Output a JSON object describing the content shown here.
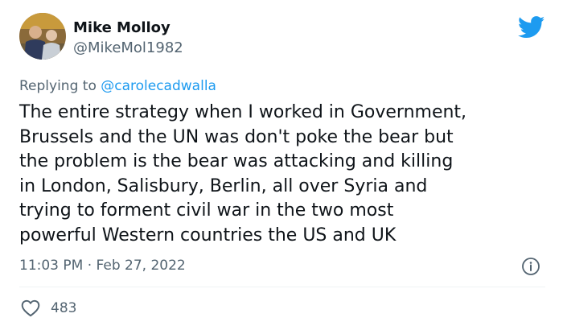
{
  "author": {
    "name": "Mike Molloy",
    "handle": "@MikeMol1982"
  },
  "reply": {
    "prefix": "Replying to ",
    "mention": "@carolecadwalla"
  },
  "tweet": {
    "lines": [
      "The entire strategy when I worked in Government,",
      "Brussels and the UN was don't poke the bear but",
      "the problem is the bear was attacking and killing",
      "in London, Salisbury, Berlin, all over Syria and",
      "trying to forment civil war in the two most",
      "powerful Western countries the US and UK"
    ],
    "time": "11:03 PM",
    "separator": " · ",
    "date": "Feb 27, 2022"
  },
  "stats": {
    "likes": "483"
  },
  "icons": {
    "logo": "twitter-bird-icon",
    "info": "info-icon",
    "like": "heart-icon"
  },
  "colors": {
    "brand": "#1d9bf0",
    "text": "#0f1419",
    "secondary": "#536471",
    "divider": "#eff3f4"
  }
}
